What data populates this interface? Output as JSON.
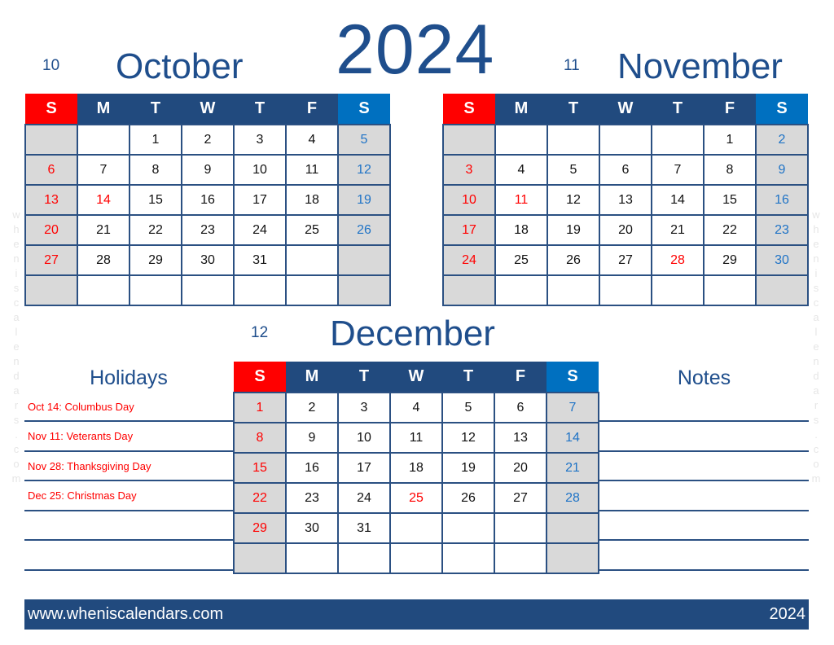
{
  "year": "2024",
  "weekday_headers": [
    "S",
    "M",
    "T",
    "W",
    "T",
    "F",
    "S"
  ],
  "months": [
    {
      "number": "10",
      "name": "October",
      "weeks": [
        [
          "",
          "",
          "1",
          "2",
          "3",
          "4",
          "5"
        ],
        [
          "6",
          "7",
          "8",
          "9",
          "10",
          "11",
          "12"
        ],
        [
          "13",
          "14",
          "15",
          "16",
          "17",
          "18",
          "19"
        ],
        [
          "20",
          "21",
          "22",
          "23",
          "24",
          "25",
          "26"
        ],
        [
          "27",
          "28",
          "29",
          "30",
          "31",
          "",
          ""
        ],
        [
          "",
          "",
          "",
          "",
          "",
          "",
          ""
        ]
      ],
      "holidays": [
        "14"
      ]
    },
    {
      "number": "11",
      "name": "November",
      "weeks": [
        [
          "",
          "",
          "",
          "",
          "",
          "1",
          "2"
        ],
        [
          "3",
          "4",
          "5",
          "6",
          "7",
          "8",
          "9"
        ],
        [
          "10",
          "11",
          "12",
          "13",
          "14",
          "15",
          "16"
        ],
        [
          "17",
          "18",
          "19",
          "20",
          "21",
          "22",
          "23"
        ],
        [
          "24",
          "25",
          "26",
          "27",
          "28",
          "29",
          "30"
        ],
        [
          "",
          "",
          "",
          "",
          "",
          "",
          ""
        ]
      ],
      "holidays": [
        "11",
        "28"
      ]
    },
    {
      "number": "12",
      "name": "December",
      "weeks": [
        [
          "1",
          "2",
          "3",
          "4",
          "5",
          "6",
          "7"
        ],
        [
          "8",
          "9",
          "10",
          "11",
          "12",
          "13",
          "14"
        ],
        [
          "15",
          "16",
          "17",
          "18",
          "19",
          "20",
          "21"
        ],
        [
          "22",
          "23",
          "24",
          "25",
          "26",
          "27",
          "28"
        ],
        [
          "29",
          "30",
          "31",
          "",
          "",
          "",
          ""
        ],
        [
          "",
          "",
          "",
          "",
          "",
          "",
          ""
        ]
      ],
      "holidays": [
        "25"
      ]
    }
  ],
  "holidays_panel": {
    "title": "Holidays",
    "items": [
      "Oct 14: Columbus Day",
      "Nov 11: Veterants Day",
      "Nov 28: Thanksgiving Day",
      "Dec 25: Christmas Day"
    ]
  },
  "notes_panel": {
    "title": "Notes"
  },
  "footer": {
    "url": "www.wheniscalendars.com",
    "year": "2024"
  },
  "watermark": "wheniscalendars.com",
  "colors": {
    "primary": "#214a7e",
    "sunday": "#ff0000",
    "saturday": "#0070c0",
    "weekend_cell": "#d9d9d9"
  }
}
